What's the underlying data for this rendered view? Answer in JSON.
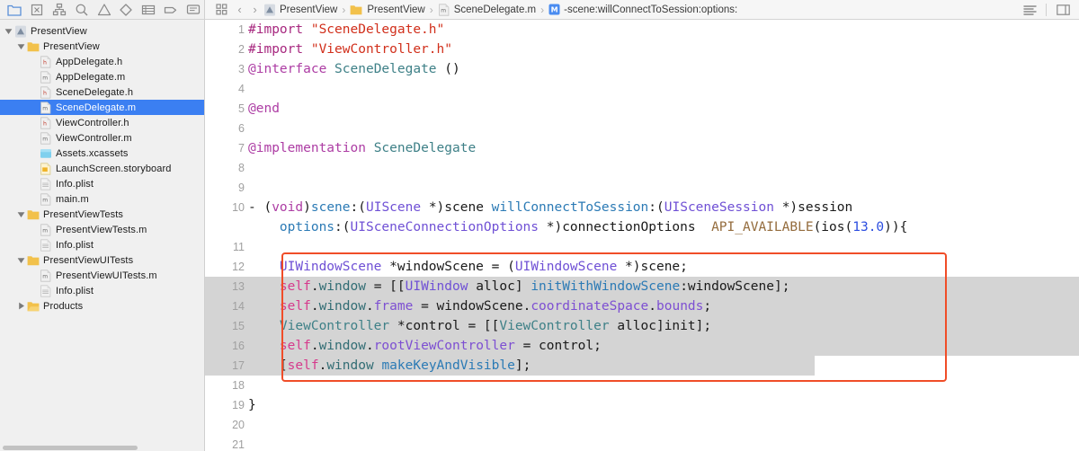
{
  "navigator_toolbar": {
    "icons": [
      {
        "name": "folder-navigator-icon",
        "glyph": "folder",
        "active": true
      },
      {
        "name": "source-control-navigator-icon",
        "glyph": "sourcecontrol",
        "active": false
      },
      {
        "name": "symbol-navigator-icon",
        "glyph": "hierarchy",
        "active": false
      },
      {
        "name": "find-navigator-icon",
        "glyph": "search",
        "active": false
      },
      {
        "name": "issue-navigator-icon",
        "glyph": "warning",
        "active": false
      },
      {
        "name": "test-navigator-icon",
        "glyph": "diamond",
        "active": false
      },
      {
        "name": "debug-navigator-icon",
        "glyph": "gauge",
        "active": false
      },
      {
        "name": "breakpoint-navigator-icon",
        "glyph": "tag",
        "active": false
      },
      {
        "name": "report-navigator-icon",
        "glyph": "message",
        "active": false
      }
    ]
  },
  "jump_bar": {
    "related_items_icon": "grid-icon",
    "back_arrow": "‹",
    "forward_arrow": "›",
    "separator": "›",
    "crumbs": [
      {
        "label": "PresentView",
        "icon": "xcode-project-icon",
        "name": "breadcrumb-project"
      },
      {
        "label": "PresentView",
        "icon": "folder-icon",
        "name": "breadcrumb-group"
      },
      {
        "label": "SceneDelegate.m",
        "icon": "m-file-icon",
        "name": "breadcrumb-file"
      },
      {
        "label": "-scene:willConnectToSession:options:",
        "icon": "method-icon",
        "name": "breadcrumb-symbol"
      }
    ]
  },
  "topbar_right": {
    "icons": [
      {
        "name": "standard-editor-icon",
        "glyph": "lines"
      },
      {
        "name": "inspector-toggle-icon",
        "glyph": "panel"
      }
    ]
  },
  "sidebar": {
    "items": [
      {
        "label": "PresentView",
        "indent": 0,
        "twisty": "down",
        "icon": "xcode-project-icon",
        "selected": false,
        "name": "project-root"
      },
      {
        "label": "PresentView",
        "indent": 1,
        "twisty": "down",
        "icon": "folder-icon",
        "selected": false,
        "name": "group-presentview"
      },
      {
        "label": "AppDelegate.h",
        "indent": 2,
        "twisty": "none",
        "icon": "h-file-icon",
        "selected": false,
        "name": "file-appdelegate-h"
      },
      {
        "label": "AppDelegate.m",
        "indent": 2,
        "twisty": "none",
        "icon": "m-file-icon",
        "selected": false,
        "name": "file-appdelegate-m"
      },
      {
        "label": "SceneDelegate.h",
        "indent": 2,
        "twisty": "none",
        "icon": "h-file-icon",
        "selected": false,
        "name": "file-scenedelegate-h"
      },
      {
        "label": "SceneDelegate.m",
        "indent": 2,
        "twisty": "none",
        "icon": "m-file-icon",
        "selected": true,
        "name": "file-scenedelegate-m"
      },
      {
        "label": "ViewController.h",
        "indent": 2,
        "twisty": "none",
        "icon": "h-file-icon",
        "selected": false,
        "name": "file-viewcontroller-h"
      },
      {
        "label": "ViewController.m",
        "indent": 2,
        "twisty": "none",
        "icon": "m-file-icon",
        "selected": false,
        "name": "file-viewcontroller-m"
      },
      {
        "label": "Assets.xcassets",
        "indent": 2,
        "twisty": "none",
        "icon": "assets-icon",
        "selected": false,
        "name": "file-assets-xcassets"
      },
      {
        "label": "LaunchScreen.storyboard",
        "indent": 2,
        "twisty": "none",
        "icon": "storyboard-icon",
        "selected": false,
        "name": "file-launchscreen-storyboard"
      },
      {
        "label": "Info.plist",
        "indent": 2,
        "twisty": "none",
        "icon": "plist-icon",
        "selected": false,
        "name": "file-info-plist-1"
      },
      {
        "label": "main.m",
        "indent": 2,
        "twisty": "none",
        "icon": "m-file-icon",
        "selected": false,
        "name": "file-main-m"
      },
      {
        "label": "PresentViewTests",
        "indent": 1,
        "twisty": "down",
        "icon": "folder-icon",
        "selected": false,
        "name": "group-presentviewtests"
      },
      {
        "label": "PresentViewTests.m",
        "indent": 2,
        "twisty": "none",
        "icon": "m-file-icon",
        "selected": false,
        "name": "file-presentviewtests-m"
      },
      {
        "label": "Info.plist",
        "indent": 2,
        "twisty": "none",
        "icon": "plist-icon",
        "selected": false,
        "name": "file-info-plist-2"
      },
      {
        "label": "PresentViewUITests",
        "indent": 1,
        "twisty": "down",
        "icon": "folder-icon",
        "selected": false,
        "name": "group-presentviewuitests"
      },
      {
        "label": "PresentViewUITests.m",
        "indent": 2,
        "twisty": "none",
        "icon": "m-file-icon",
        "selected": false,
        "name": "file-presentviewuitests-m"
      },
      {
        "label": "Info.plist",
        "indent": 2,
        "twisty": "none",
        "icon": "plist-icon",
        "selected": false,
        "name": "file-info-plist-3"
      },
      {
        "label": "Products",
        "indent": 1,
        "twisty": "right",
        "icon": "folder-yellow-icon",
        "selected": false,
        "name": "group-products"
      }
    ]
  },
  "editor": {
    "filename": "SceneDelegate.m",
    "annotation": {
      "name": "red-highlight-box",
      "color": "#f04d28",
      "covers_lines": [
        12,
        17
      ]
    },
    "selection": {
      "color": "#d4d4d4",
      "lines": [
        13,
        14,
        15,
        16,
        17
      ]
    },
    "lines": [
      {
        "n": 1,
        "tokens": [
          {
            "t": "#import ",
            "c": "s-pre"
          },
          {
            "t": "\"SceneDelegate.h\"",
            "c": "s-str"
          }
        ]
      },
      {
        "n": 2,
        "tokens": [
          {
            "t": "#import ",
            "c": "s-pre"
          },
          {
            "t": "\"ViewController.h\"",
            "c": "s-str"
          }
        ]
      },
      {
        "n": 3,
        "tokens": [
          {
            "t": "@interface",
            "c": "s-kw"
          },
          {
            "t": " ",
            "c": "s-plain"
          },
          {
            "t": "SceneDelegate",
            "c": "s-type"
          },
          {
            "t": " ()",
            "c": "s-plain"
          }
        ]
      },
      {
        "n": 4,
        "tokens": []
      },
      {
        "n": 5,
        "tokens": [
          {
            "t": "@end",
            "c": "s-kw"
          }
        ]
      },
      {
        "n": 6,
        "tokens": []
      },
      {
        "n": 7,
        "tokens": [
          {
            "t": "@implementation",
            "c": "s-kw"
          },
          {
            "t": " ",
            "c": "s-plain"
          },
          {
            "t": "SceneDelegate",
            "c": "s-type"
          }
        ]
      },
      {
        "n": 8,
        "tokens": []
      },
      {
        "n": 9,
        "tokens": []
      },
      {
        "n": 10,
        "tokens": [
          {
            "t": "- (",
            "c": "s-plain"
          },
          {
            "t": "void",
            "c": "s-kw"
          },
          {
            "t": ")",
            "c": "s-plain"
          },
          {
            "t": "scene",
            "c": "s-sel"
          },
          {
            "t": ":(",
            "c": "s-plain"
          },
          {
            "t": "UIScene",
            "c": "s-cls"
          },
          {
            "t": " *)scene ",
            "c": "s-plain"
          },
          {
            "t": "willConnectToSession",
            "c": "s-sel"
          },
          {
            "t": ":(",
            "c": "s-plain"
          },
          {
            "t": "UISceneSession",
            "c": "s-cls"
          },
          {
            "t": " *)session",
            "c": "s-plain"
          }
        ]
      },
      {
        "n": null,
        "indent": 2,
        "tokens": [
          {
            "t": "    ",
            "c": "s-plain"
          },
          {
            "t": "options",
            "c": "s-sel"
          },
          {
            "t": ":(",
            "c": "s-plain"
          },
          {
            "t": "UISceneConnectionOptions",
            "c": "s-cls"
          },
          {
            "t": " *)connectionOptions  ",
            "c": "s-plain"
          },
          {
            "t": "API_AVAILABLE",
            "c": "s-macro"
          },
          {
            "t": "(ios(",
            "c": "s-plain"
          },
          {
            "t": "13.0",
            "c": "s-num"
          },
          {
            "t": ")){",
            "c": "s-plain"
          }
        ]
      },
      {
        "n": 11,
        "tokens": []
      },
      {
        "n": 12,
        "tokens": [
          {
            "t": "    ",
            "c": "s-plain"
          },
          {
            "t": "UIWindowScene",
            "c": "s-cls"
          },
          {
            "t": " *windowScene = (",
            "c": "s-plain"
          },
          {
            "t": "UIWindowScene",
            "c": "s-cls"
          },
          {
            "t": " *)scene;",
            "c": "s-plain"
          }
        ]
      },
      {
        "n": 13,
        "tokens": [
          {
            "t": "    ",
            "c": "s-plain"
          },
          {
            "t": "self",
            "c": "s-self"
          },
          {
            "t": ".",
            "c": "s-plain"
          },
          {
            "t": "window",
            "c": "s-msg"
          },
          {
            "t": " = [[",
            "c": "s-plain"
          },
          {
            "t": "UIWindow",
            "c": "s-cls"
          },
          {
            "t": " ",
            "c": "s-plain"
          },
          {
            "t": "alloc",
            "c": "s-plain"
          },
          {
            "t": "] ",
            "c": "s-plain"
          },
          {
            "t": "initWithWindowScene",
            "c": "s-sel"
          },
          {
            "t": ":windowScene];",
            "c": "s-plain"
          }
        ]
      },
      {
        "n": 14,
        "tokens": [
          {
            "t": "    ",
            "c": "s-plain"
          },
          {
            "t": "self",
            "c": "s-self"
          },
          {
            "t": ".",
            "c": "s-plain"
          },
          {
            "t": "window",
            "c": "s-msg"
          },
          {
            "t": ".",
            "c": "s-plain"
          },
          {
            "t": "frame",
            "c": "s-prop"
          },
          {
            "t": " = windowScene.",
            "c": "s-plain"
          },
          {
            "t": "coordinateSpace",
            "c": "s-prop"
          },
          {
            "t": ".",
            "c": "s-plain"
          },
          {
            "t": "bounds",
            "c": "s-prop"
          },
          {
            "t": ";",
            "c": "s-plain"
          }
        ]
      },
      {
        "n": 15,
        "tokens": [
          {
            "t": "    ",
            "c": "s-plain"
          },
          {
            "t": "ViewController",
            "c": "s-type"
          },
          {
            "t": " *control = [[",
            "c": "s-plain"
          },
          {
            "t": "ViewController",
            "c": "s-type"
          },
          {
            "t": " ",
            "c": "s-plain"
          },
          {
            "t": "alloc",
            "c": "s-plain"
          },
          {
            "t": "]",
            "c": "s-plain"
          },
          {
            "t": "init",
            "c": "s-plain"
          },
          {
            "t": "];",
            "c": "s-plain"
          }
        ]
      },
      {
        "n": 16,
        "tokens": [
          {
            "t": "    ",
            "c": "s-plain"
          },
          {
            "t": "self",
            "c": "s-self"
          },
          {
            "t": ".",
            "c": "s-plain"
          },
          {
            "t": "window",
            "c": "s-msg"
          },
          {
            "t": ".",
            "c": "s-plain"
          },
          {
            "t": "rootViewController",
            "c": "s-prop"
          },
          {
            "t": " = control;",
            "c": "s-plain"
          }
        ]
      },
      {
        "n": 17,
        "tokens": [
          {
            "t": "    [",
            "c": "s-plain"
          },
          {
            "t": "self",
            "c": "s-self"
          },
          {
            "t": ".",
            "c": "s-plain"
          },
          {
            "t": "window",
            "c": "s-msg"
          },
          {
            "t": " ",
            "c": "s-plain"
          },
          {
            "t": "makeKeyAndVisible",
            "c": "s-sel"
          },
          {
            "t": "];",
            "c": "s-plain"
          }
        ]
      },
      {
        "n": 18,
        "tokens": []
      },
      {
        "n": 19,
        "tokens": [
          {
            "t": "}",
            "c": "s-plain"
          }
        ]
      },
      {
        "n": 20,
        "tokens": []
      },
      {
        "n": 21,
        "tokens": []
      }
    ]
  }
}
